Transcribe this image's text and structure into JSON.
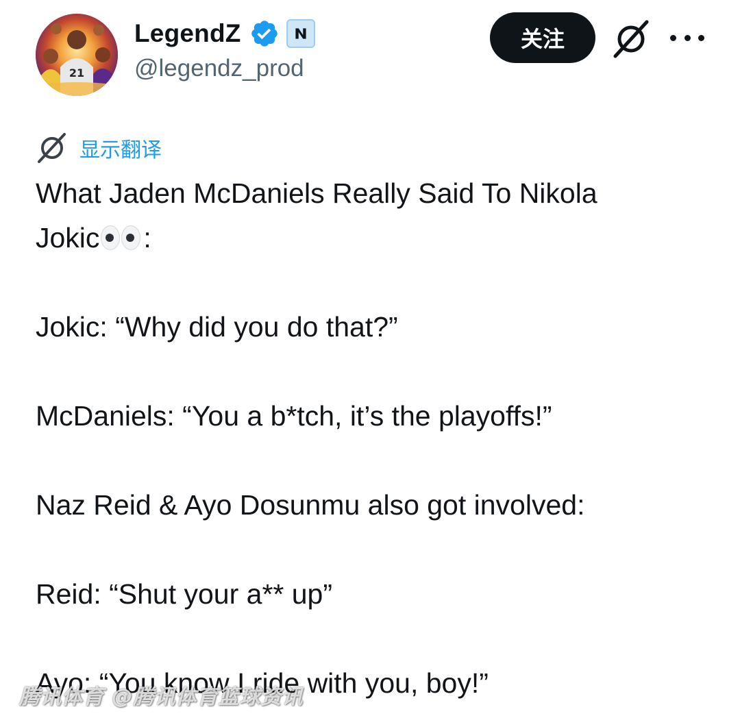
{
  "author": {
    "display_name": "LegendZ",
    "handle": "@legendz_prod",
    "avatar_icon": "basketball-legends-collage-avatar",
    "verified_icon": "verified-badge-icon",
    "affiliate_icon": "affiliate-badge-icon"
  },
  "actions": {
    "follow_label": "关注",
    "grok_icon": "grok-icon",
    "more_icon": "more-options-icon"
  },
  "translate": {
    "label": "显示翻译",
    "icon": "grok-translate-icon"
  },
  "tweet": {
    "line1": "What Jaden McDaniels Really Said To Nikola",
    "line2_prefix": "Jokic",
    "line2_suffix": ":",
    "line3": "Jokic: “Why did you do that?”",
    "line4": "McDaniels: “You a b*tch, it’s the playoffs!”",
    "line5": "Naz Reid & Ayo Dosunmu also got involved:",
    "line6": "Reid: “Shut your a** up”",
    "line7": "Ayo: “You know I ride with you, boy!”"
  },
  "watermark": {
    "text": "腾讯体育 @腾讯体育篮球资讯"
  },
  "colors": {
    "text": "#0f1419",
    "secondary": "#536471",
    "accent": "#1d9bf0",
    "button_bg": "#0f1419"
  }
}
